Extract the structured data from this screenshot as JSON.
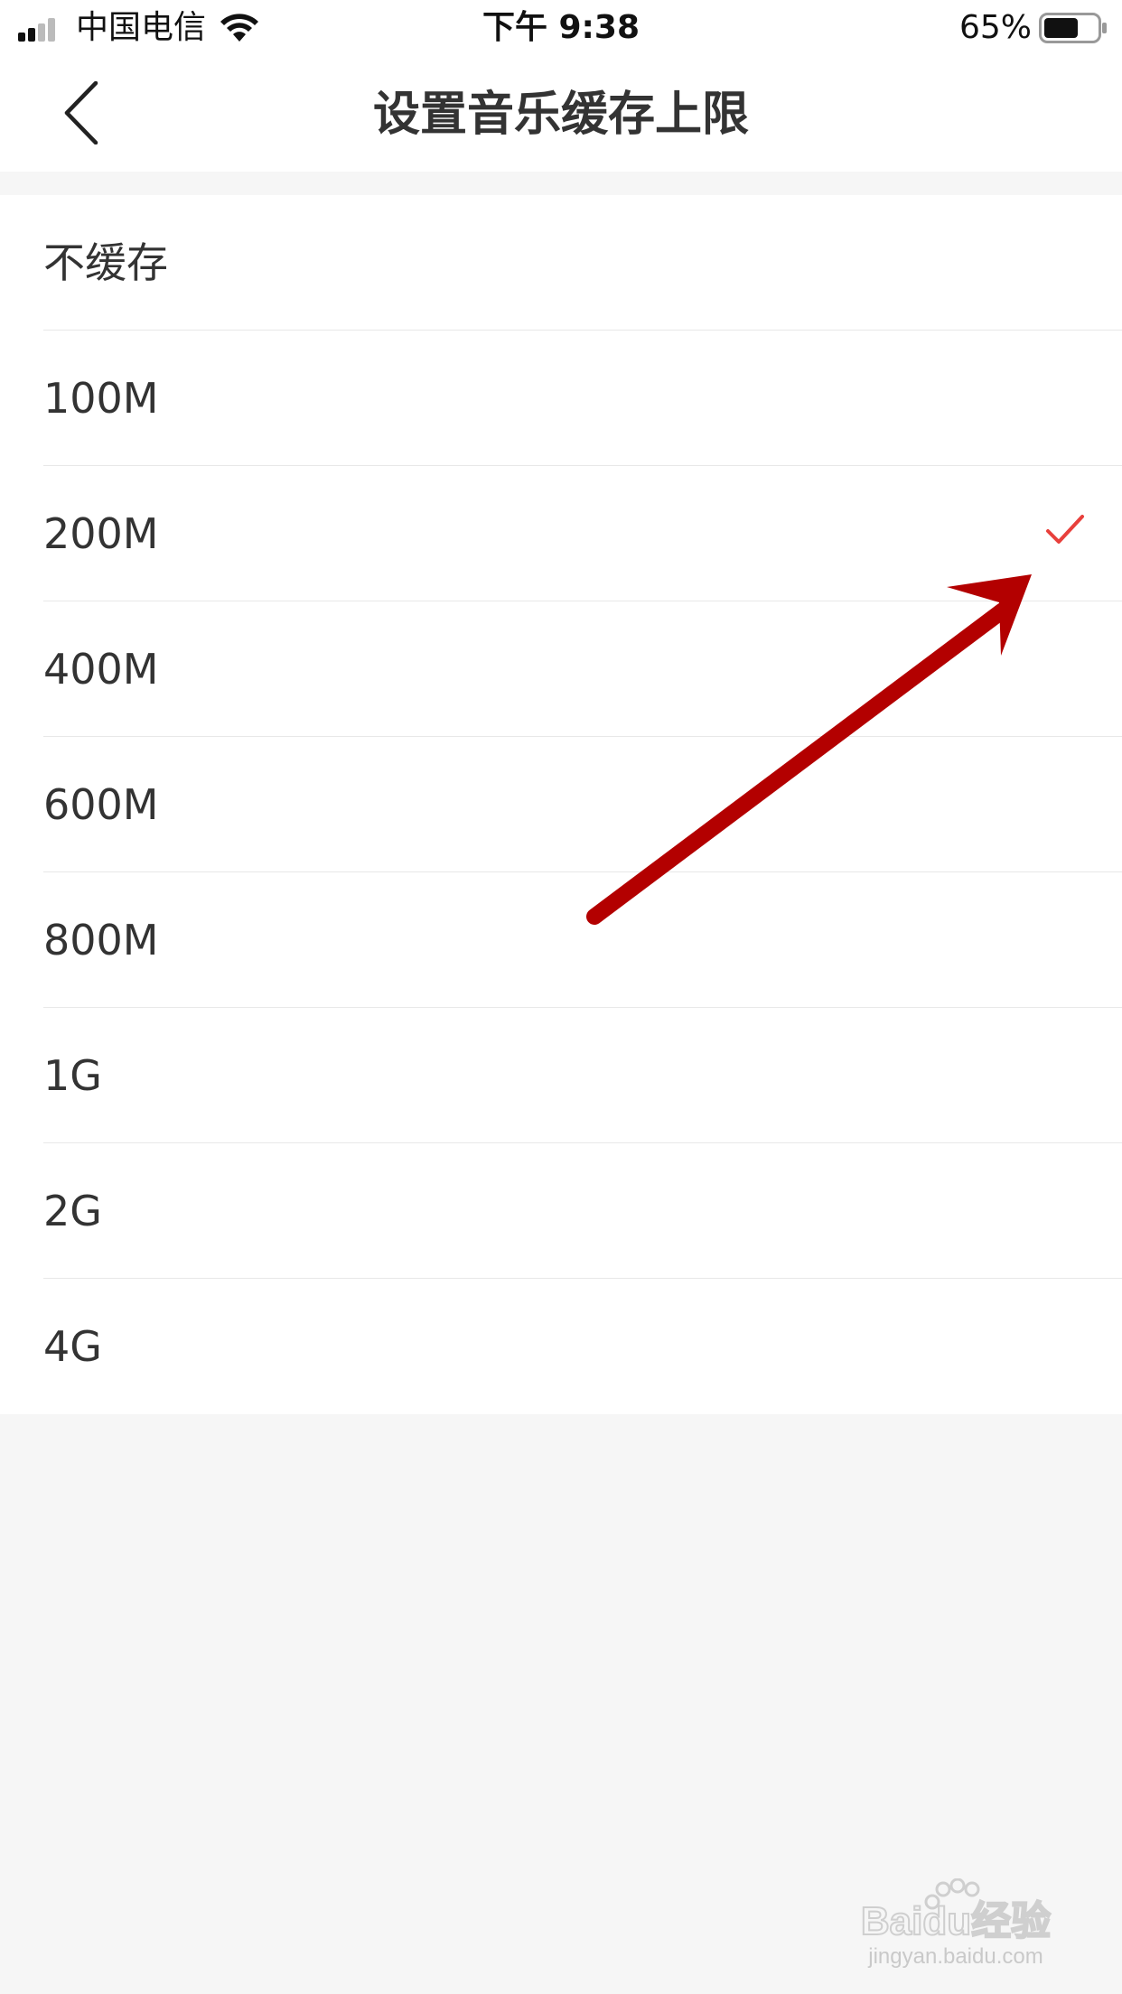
{
  "status_bar": {
    "carrier": "中国电信",
    "time": "下午 9:38",
    "battery_percent": "65%",
    "battery_level": 0.65,
    "signal_bars_active": 2
  },
  "nav": {
    "title": "设置音乐缓存上限",
    "back_icon": "chevron-left-icon"
  },
  "cache_options": {
    "selected": "200M",
    "accent_color": "#e8403c",
    "items": [
      {
        "label": "不缓存"
      },
      {
        "label": "100M"
      },
      {
        "label": "200M"
      },
      {
        "label": "400M"
      },
      {
        "label": "600M"
      },
      {
        "label": "800M"
      },
      {
        "label": "1G"
      },
      {
        "label": "2G"
      },
      {
        "label": "4G"
      }
    ]
  },
  "annotation": {
    "arrow_color": "#b30000"
  },
  "watermark": {
    "logo_text": "Baidu经验",
    "url": "jingyan.baidu.com"
  }
}
